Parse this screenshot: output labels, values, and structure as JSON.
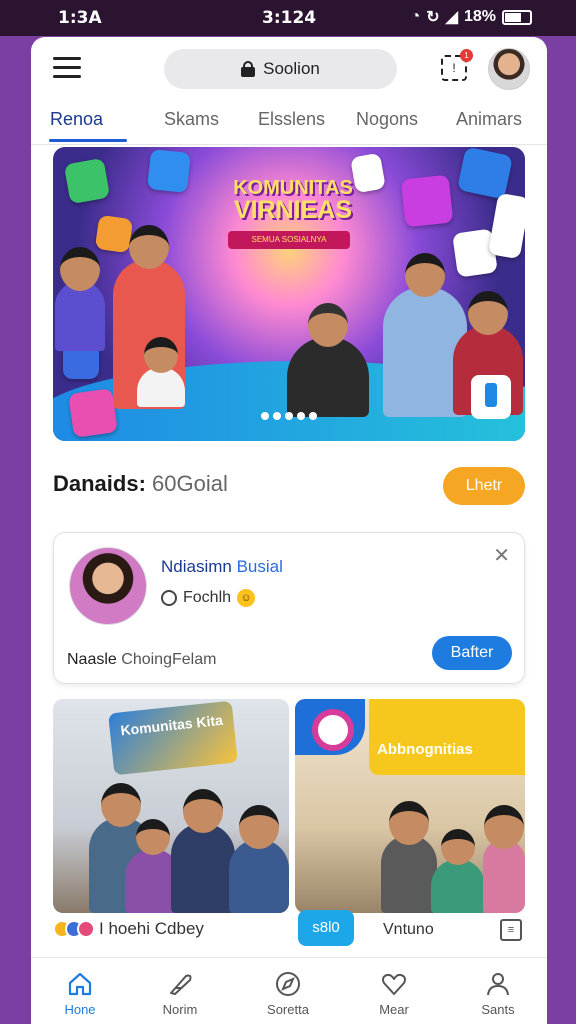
{
  "status_bar": {
    "time": "1:3A",
    "center_text": "3:124",
    "battery": "18%"
  },
  "header": {
    "search_label": "Soolion",
    "notification_count": "1",
    "notification_glyph": "!"
  },
  "tabs": [
    {
      "label": "Renoa",
      "active": true
    },
    {
      "label": "Skams",
      "active": false
    },
    {
      "label": "Elsslens",
      "active": false
    },
    {
      "label": "Nogons",
      "active": false
    },
    {
      "label": "Animars",
      "active": false
    }
  ],
  "hero": {
    "title_line1": "KOMUNITAS",
    "title_line2": "VIRNIEAS",
    "ribbon_text": "SEMUA SOSIALNYA",
    "slide_count": 5,
    "active_slide": 1
  },
  "section": {
    "title_bold": "Danaids",
    "title_light": "60Goial",
    "action_label": "Lhetr"
  },
  "post_card": {
    "name_part1": "Ndiasimn",
    "name_part2": "Busial",
    "status_text": "Fochlh",
    "footer_bold": "Naasle",
    "footer_light": "ChoingFelam",
    "button_label": "Bafter",
    "close_glyph": "✕"
  },
  "tiles": [
    {
      "sign_text": "Komunitas Kita",
      "meta_text": "I hoehi Cdbey"
    },
    {
      "banner_text": "Abbnognitias",
      "button_label": "s8l0",
      "meta_text": "Vntuno"
    }
  ],
  "bottom_nav": [
    {
      "label": "Hone",
      "icon": "home-icon",
      "active": true
    },
    {
      "label": "Norim",
      "icon": "feather-icon",
      "active": false
    },
    {
      "label": "Soretta",
      "icon": "compass-icon",
      "active": false
    },
    {
      "label": "Mear",
      "icon": "heart-icon",
      "active": false
    },
    {
      "label": "Sants",
      "icon": "person-icon",
      "active": false
    }
  ],
  "colors": {
    "accent_blue": "#1e7be0",
    "accent_orange": "#f5a623",
    "tab_active": "#1a3a8f",
    "frame_purple": "#7b3fa3"
  }
}
